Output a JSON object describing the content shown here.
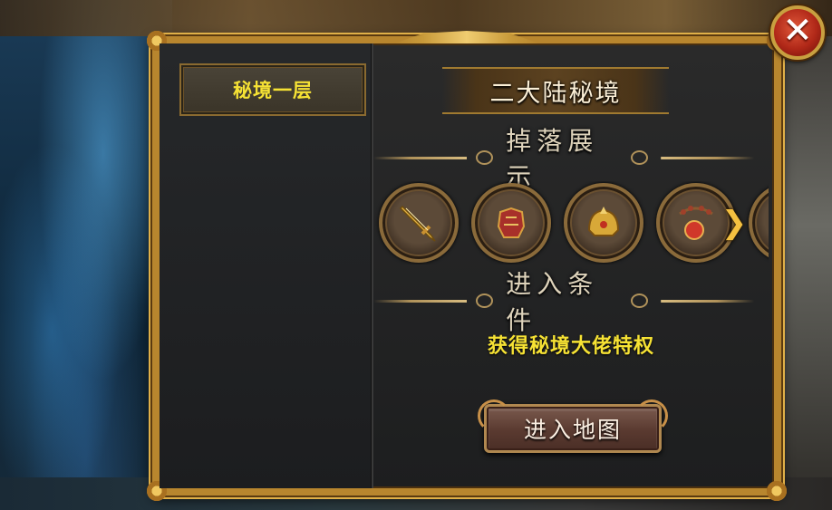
{
  "panel": {
    "layers": [
      {
        "label": "秘境一层",
        "selected": true
      }
    ],
    "title": "二大陆秘境",
    "drops_heading": "掉落展示",
    "drops": [
      {
        "icon": "sword-icon"
      },
      {
        "icon": "red-armor-icon"
      },
      {
        "icon": "golden-helmet-icon"
      },
      {
        "icon": "bead-necklace-icon"
      },
      {
        "icon": "partial-item-icon"
      }
    ],
    "next_arrow": "❯",
    "conditions_heading": "进入条件",
    "condition_text": "获得秘境大佬特权",
    "enter_button": "进入地图"
  },
  "close": {
    "icon": "close-icon",
    "glyph": "✕"
  },
  "colors": {
    "highlight_text": "#f6e234",
    "frame_gold": "#b8862e",
    "close_red": "#b02818"
  }
}
